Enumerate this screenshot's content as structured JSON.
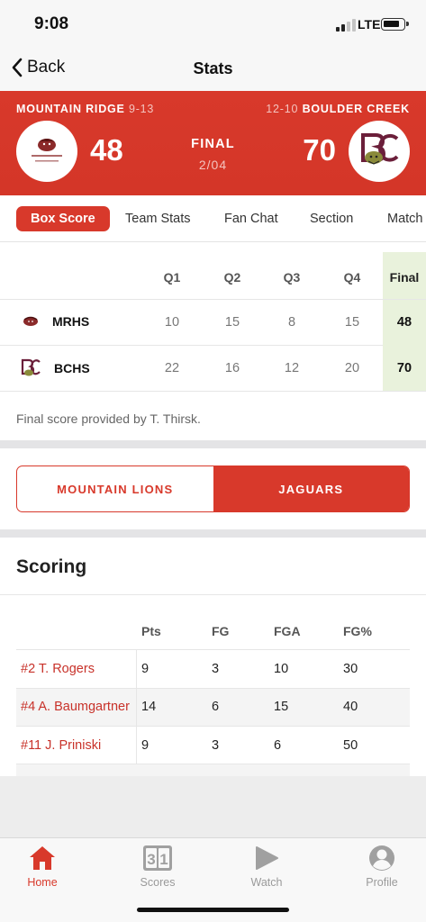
{
  "status_bar": {
    "time": "9:08",
    "network": "LTE"
  },
  "nav": {
    "back_label": "Back",
    "title": "Stats"
  },
  "game": {
    "home": {
      "name": "MOUNTAIN RIDGE",
      "record": "9-13",
      "score": "48"
    },
    "away": {
      "name": "BOULDER CREEK",
      "record": "12-10",
      "score": "70"
    },
    "status": "FINAL",
    "date": "2/04"
  },
  "tabs": [
    "Box Score",
    "Team Stats",
    "Fan Chat",
    "Section",
    "Match"
  ],
  "box_score": {
    "headers": [
      "Q1",
      "Q2",
      "Q3",
      "Q4",
      "Final"
    ],
    "rows": [
      {
        "team": "MRHS",
        "quarters": [
          "10",
          "15",
          "8",
          "15"
        ],
        "final": "48"
      },
      {
        "team": "BCHS",
        "quarters": [
          "22",
          "16",
          "12",
          "20"
        ],
        "final": "70"
      }
    ],
    "provided_by": "Final score provided by T. Thirsk."
  },
  "team_toggle": {
    "left": "MOUNTAIN LIONS",
    "right": "JAGUARS"
  },
  "scoring": {
    "title": "Scoring",
    "headers": [
      "Pts",
      "FG",
      "FGA",
      "FG%"
    ],
    "rows": [
      {
        "player": "#2 T. Rogers",
        "pts": "9",
        "fg": "3",
        "fga": "10",
        "fgp": "30"
      },
      {
        "player": "#4 A. Baumgartner",
        "pts": "14",
        "fg": "6",
        "fga": "15",
        "fgp": "40"
      },
      {
        "player": "#11 J. Priniski",
        "pts": "9",
        "fg": "3",
        "fga": "6",
        "fgp": "50"
      }
    ]
  },
  "tab_bar": [
    {
      "label": "Home",
      "icon": "home-icon"
    },
    {
      "label": "Scores",
      "icon": "scoreboard-icon"
    },
    {
      "label": "Watch",
      "icon": "play-icon"
    },
    {
      "label": "Profile",
      "icon": "profile-icon"
    }
  ],
  "colors": {
    "accent": "#d8392b",
    "final_column": "#e9f2dc"
  }
}
